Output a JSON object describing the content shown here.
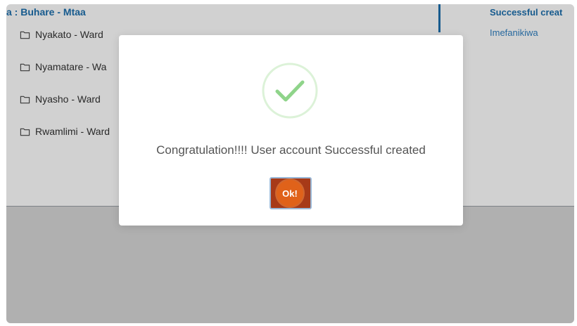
{
  "tree": {
    "title": "a : Buhare - Mtaa",
    "items": [
      {
        "label": "Nyakato - Ward"
      },
      {
        "label": "Nyamatare - Wa"
      },
      {
        "label": "Nyasho - Ward"
      },
      {
        "label": "Rwamlimi - Ward"
      }
    ]
  },
  "notification": {
    "title": "Successful creat",
    "message": "Imefanikiwa"
  },
  "modal": {
    "icon": "check-icon",
    "message": "Congratulation!!!! User account Successful created",
    "ok_label": "Ok!"
  },
  "colors": {
    "accent": "#1d6fae",
    "ok_button": "#a73a18",
    "ok_highlight": "#e0621a",
    "check": "#8fd48a"
  }
}
